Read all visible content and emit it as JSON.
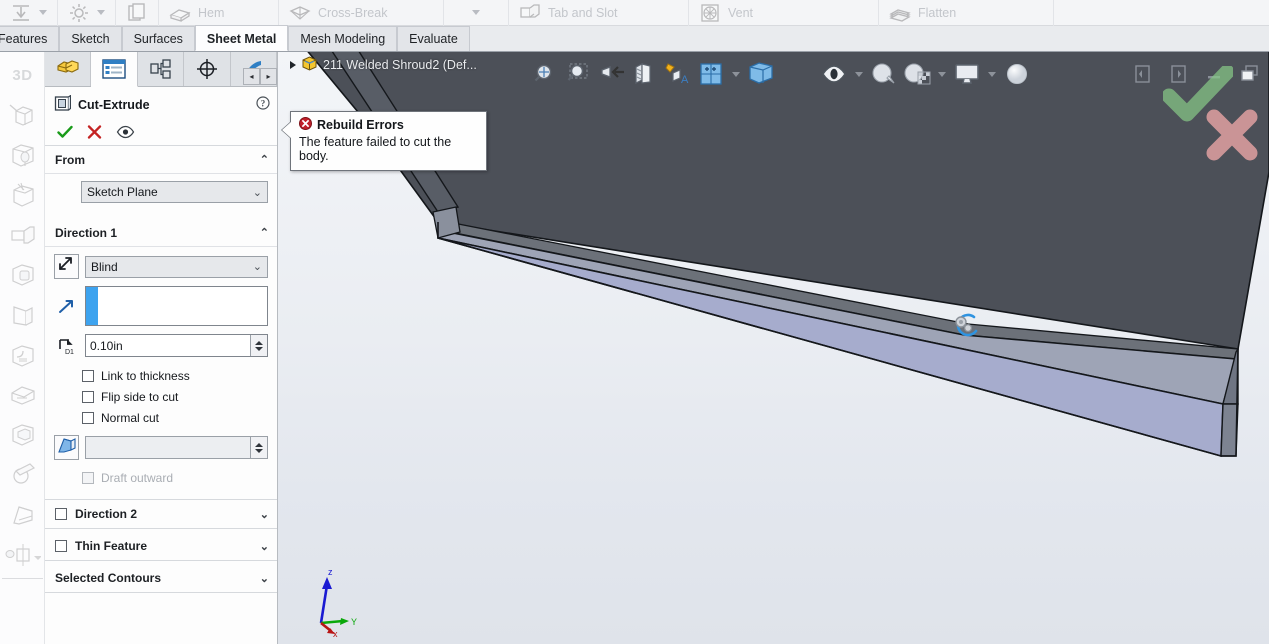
{
  "ribbon": {
    "groups": [
      {
        "label": "",
        "icon": "insert-bends-icon",
        "caret": true
      },
      {
        "label": "",
        "icon": "gear-icon",
        "caret": true
      },
      {
        "label": "",
        "icon": "copy-icon",
        "caret": false
      },
      {
        "label": "Hem",
        "icon": "hem-icon",
        "caret": false
      },
      {
        "label": "Cross-Break",
        "icon": "cross-break-icon",
        "caret": false
      },
      {
        "label": "",
        "icon": "more-icon",
        "caret": true
      },
      {
        "label": "Tab and Slot",
        "icon": "tab-and-slot-icon",
        "caret": false
      },
      {
        "label": "Vent",
        "icon": "vent-icon",
        "caret": false
      },
      {
        "label": "Flatten",
        "icon": "flatten-icon",
        "caret": false
      }
    ]
  },
  "command_tabs": [
    {
      "label": "Features",
      "active": false
    },
    {
      "label": "Sketch",
      "active": false
    },
    {
      "label": "Surfaces",
      "active": false
    },
    {
      "label": "Sheet Metal",
      "active": true
    },
    {
      "label": "Mesh Modeling",
      "active": false
    },
    {
      "label": "Evaluate",
      "active": false
    }
  ],
  "left_toolbar": {
    "items": [
      {
        "name": "3d-sketch-label",
        "label": "3D"
      },
      {
        "name": "extruded-boss-icon",
        "label": ""
      },
      {
        "name": "extruded-cut-icon",
        "label": ""
      },
      {
        "name": "revolved-boss-icon",
        "label": ""
      },
      {
        "name": "swept-boss-icon",
        "label": ""
      },
      {
        "name": "lofted-boss-icon",
        "label": ""
      },
      {
        "name": "rib-icon",
        "label": ""
      },
      {
        "name": "fillet-icon",
        "label": ""
      },
      {
        "name": "chamfer-icon",
        "label": ""
      },
      {
        "name": "shell-icon",
        "label": ""
      },
      {
        "name": "wrap-icon",
        "label": ""
      },
      {
        "name": "draft-icon",
        "label": ""
      },
      {
        "name": "mirror-icon",
        "label": ""
      }
    ]
  },
  "property_manager": {
    "tabs": [
      {
        "name": "feature-manager-tab",
        "icon": "yellow-block-icon",
        "active": false
      },
      {
        "name": "property-manager-tab",
        "icon": "property-list-icon",
        "active": true
      },
      {
        "name": "configuration-manager-tab",
        "icon": "config-tree-icon",
        "active": false
      },
      {
        "name": "dimxpert-manager-tab",
        "icon": "crosshair-circle-icon",
        "active": false
      },
      {
        "name": "display-manager-tab",
        "icon": "appearance-icon",
        "active": false
      }
    ],
    "scroll_left": "◂",
    "scroll_right": "▸",
    "title": "Cut-Extrude",
    "title_icon": "cut-extrude-icon",
    "help_icon": "help-icon",
    "actions": [
      {
        "name": "ok-button",
        "icon": "green-check-icon"
      },
      {
        "name": "cancel-button",
        "icon": "red-x-icon"
      },
      {
        "name": "preview-button",
        "icon": "eye-icon"
      }
    ],
    "sections": {
      "from": {
        "title": "From",
        "chevron": "⌃",
        "dropdown_value": "Sketch Plane",
        "dropdown_caret": "⌄"
      },
      "direction1": {
        "title": "Direction 1",
        "chevron": "⌃",
        "reverse_icon": "reverse-direction-icon",
        "end_condition": "Blind",
        "end_condition_caret": "⌄",
        "direction_ref_icon": "direction-vector-icon",
        "direction_ref_value": "",
        "depth_icon": "depth-d1-icon",
        "depth_value": "0.10in",
        "checkboxes": [
          {
            "label": "Link to thickness",
            "checked": false,
            "disabled": false
          },
          {
            "label": "Flip side to cut",
            "checked": false,
            "disabled": false
          },
          {
            "label": "Normal cut",
            "checked": false,
            "disabled": false
          }
        ],
        "draft_icon": "draft-angle-icon",
        "draft_value": "",
        "draft_outward": {
          "label": "Draft outward",
          "checked": false,
          "disabled": true
        }
      },
      "direction2": {
        "title": "Direction 2",
        "checked": false,
        "chevron": "⌄"
      },
      "thin_feature": {
        "title": "Thin Feature",
        "checked": false,
        "chevron": "⌄"
      },
      "selected_contours": {
        "title": "Selected Contours",
        "chevron": "⌄"
      }
    }
  },
  "graphics": {
    "tree_item": {
      "label": "211 Welded Shroud2  (Def...",
      "icon": "part-cube-icon",
      "expander": "▶"
    },
    "callout": {
      "icon": "error-badge-icon",
      "title": "Rebuild Errors",
      "message": "The feature failed to cut the body."
    },
    "toolbar": [
      {
        "name": "zoom-to-fit-icon",
        "caret": false
      },
      {
        "name": "zoom-to-area-icon",
        "caret": false
      },
      {
        "name": "previous-view-icon",
        "caret": false
      },
      {
        "name": "section-view-icon",
        "caret": false
      },
      {
        "name": "view-orientation-icon",
        "caret": false
      },
      {
        "name": "display-style-icon",
        "caret": true
      },
      {
        "name": "hide-show-items-icon",
        "caret": false
      },
      {
        "name": "edit-appearance-icon",
        "caret": false
      },
      {
        "name": "apply-scene-icon",
        "caret": true
      },
      {
        "name": "view-settings-icon",
        "caret": true
      },
      {
        "name": "sphere-preview-icon",
        "caret": false
      }
    ],
    "window_controls": [
      {
        "name": "restore-left-icon"
      },
      {
        "name": "restore-right-icon"
      },
      {
        "name": "minimize-icon"
      },
      {
        "name": "restore-window-icon"
      }
    ],
    "confirmation_corner": {
      "accept_icon": "green-check-large-icon",
      "cancel_icon": "red-x-large-icon"
    },
    "triad": {
      "x_label": "x",
      "y_label": "Y",
      "z_label": "z"
    },
    "selection_marker": "selected-vertex-icon"
  },
  "colors": {
    "model_top_face": "#4c5058",
    "model_side_face": "#9ea4b6",
    "model_edge": "#14171b",
    "accent_blue": "#3da3ef",
    "error_red": "#c0202a",
    "ok_green": "#169016",
    "background_top": "#f3f5f8",
    "background_bottom": "#dfe3ea"
  }
}
